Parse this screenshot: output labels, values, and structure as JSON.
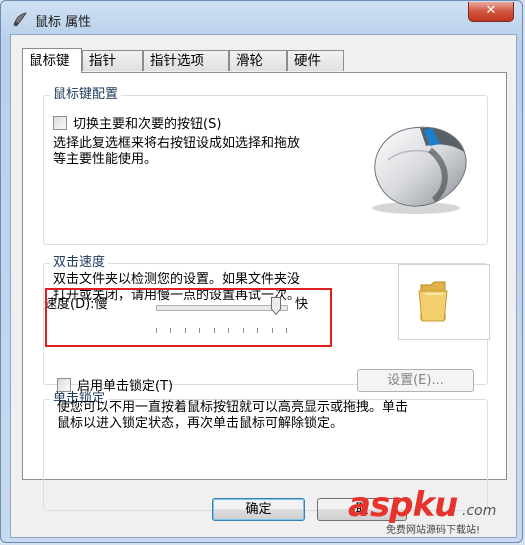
{
  "window": {
    "title": "鼠标 属性",
    "close_glyph": "✕"
  },
  "tabs": [
    {
      "label": "鼠标键",
      "active": true
    },
    {
      "label": "指针",
      "active": false
    },
    {
      "label": "指针选项",
      "active": false
    },
    {
      "label": "滑轮",
      "active": false
    },
    {
      "label": "硬件",
      "active": false
    }
  ],
  "button_config": {
    "title": "鼠标键配置",
    "checkbox_label": "切换主要和次要的按钮(S)",
    "checkbox_checked": false,
    "description_line1": "选择此复选框来将右按钮设成如选择和拖放",
    "description_line2": "等主要性能使用。"
  },
  "double_click": {
    "title": "双击速度",
    "description_line1": "双击文件夹以检测您的设置。如果文件夹没",
    "description_line2": "打开或关闭，请用慢一点的设置再试一次。",
    "speed_label": "速度(D):慢",
    "fast_label": "快",
    "slider_fraction": 0.92
  },
  "click_lock": {
    "title": "单击锁定",
    "checkbox_label": "启用单击锁定(T)",
    "checkbox_checked": false,
    "settings_button": "设置(E)...",
    "description_line1": "使您可以不用一直按着鼠标按钮就可以高亮显示或拖拽。单击",
    "description_line2": "鼠标以进入锁定状态，再次单击鼠标可解除锁定。"
  },
  "footer": {
    "ok_label": "确定",
    "cancel_label": "取"
  },
  "watermark": {
    "brand": "aspku",
    "suffix": ".com",
    "tagline": "免费网站源码下载站!"
  },
  "colors": {
    "highlight_box": "#e02020",
    "group_title": "#1e395b",
    "close_button": "#c9442f"
  }
}
